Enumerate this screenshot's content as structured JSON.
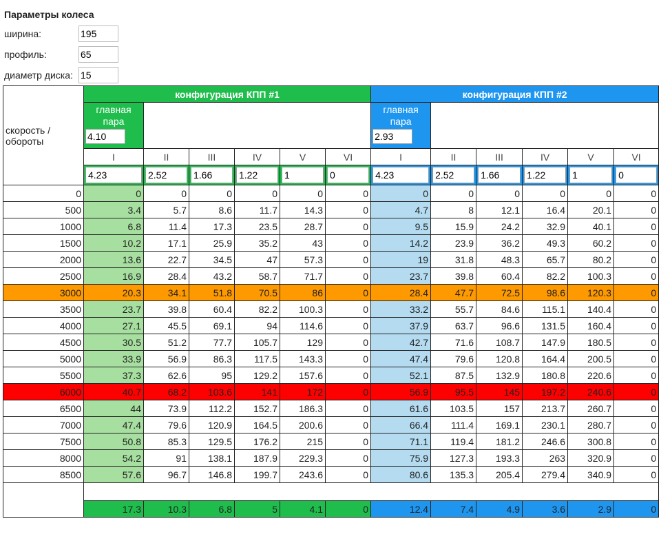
{
  "wheel": {
    "title": "Параметры колеса",
    "width_label": "ширина:",
    "width_value": "195",
    "profile_label": "профиль:",
    "profile_value": "65",
    "diameter_label": "диаметр диска:",
    "diameter_value": "15"
  },
  "table": {
    "speed_label": "скорость / обороты",
    "main_pair_label": "главная пара",
    "gears": [
      "I",
      "II",
      "III",
      "IV",
      "V",
      "VI"
    ],
    "config1": {
      "title": "конфигурация КПП #1",
      "main_pair": "4.10",
      "ratios": [
        "4.23",
        "2.52",
        "1.66",
        "1.22",
        "1",
        "0"
      ]
    },
    "config2": {
      "title": "конфигурация КПП #2",
      "main_pair": "2.93",
      "ratios": [
        "4.23",
        "2.52",
        "1.66",
        "1.22",
        "1",
        "0"
      ]
    },
    "rows": [
      {
        "rpm": "0",
        "c1": [
          "0",
          "0",
          "0",
          "0",
          "0",
          "0"
        ],
        "c2": [
          "0",
          "0",
          "0",
          "0",
          "0",
          "0"
        ]
      },
      {
        "rpm": "500",
        "c1": [
          "3.4",
          "5.7",
          "8.6",
          "11.7",
          "14.3",
          "0"
        ],
        "c2": [
          "4.7",
          "8",
          "12.1",
          "16.4",
          "20.1",
          "0"
        ]
      },
      {
        "rpm": "1000",
        "c1": [
          "6.8",
          "11.4",
          "17.3",
          "23.5",
          "28.7",
          "0"
        ],
        "c2": [
          "9.5",
          "15.9",
          "24.2",
          "32.9",
          "40.1",
          "0"
        ]
      },
      {
        "rpm": "1500",
        "c1": [
          "10.2",
          "17.1",
          "25.9",
          "35.2",
          "43",
          "0"
        ],
        "c2": [
          "14.2",
          "23.9",
          "36.2",
          "49.3",
          "60.2",
          "0"
        ]
      },
      {
        "rpm": "2000",
        "c1": [
          "13.6",
          "22.7",
          "34.5",
          "47",
          "57.3",
          "0"
        ],
        "c2": [
          "19",
          "31.8",
          "48.3",
          "65.7",
          "80.2",
          "0"
        ]
      },
      {
        "rpm": "2500",
        "c1": [
          "16.9",
          "28.4",
          "43.2",
          "58.7",
          "71.7",
          "0"
        ],
        "c2": [
          "23.7",
          "39.8",
          "60.4",
          "82.2",
          "100.3",
          "0"
        ]
      },
      {
        "rpm": "3000",
        "c1": [
          "20.3",
          "34.1",
          "51.8",
          "70.5",
          "86",
          "0"
        ],
        "c2": [
          "28.4",
          "47.7",
          "72.5",
          "98.6",
          "120.3",
          "0"
        ],
        "highlight": "orange"
      },
      {
        "rpm": "3500",
        "c1": [
          "23.7",
          "39.8",
          "60.4",
          "82.2",
          "100.3",
          "0"
        ],
        "c2": [
          "33.2",
          "55.7",
          "84.6",
          "115.1",
          "140.4",
          "0"
        ]
      },
      {
        "rpm": "4000",
        "c1": [
          "27.1",
          "45.5",
          "69.1",
          "94",
          "114.6",
          "0"
        ],
        "c2": [
          "37.9",
          "63.7",
          "96.6",
          "131.5",
          "160.4",
          "0"
        ]
      },
      {
        "rpm": "4500",
        "c1": [
          "30.5",
          "51.2",
          "77.7",
          "105.7",
          "129",
          "0"
        ],
        "c2": [
          "42.7",
          "71.6",
          "108.7",
          "147.9",
          "180.5",
          "0"
        ]
      },
      {
        "rpm": "5000",
        "c1": [
          "33.9",
          "56.9",
          "86.3",
          "117.5",
          "143.3",
          "0"
        ],
        "c2": [
          "47.4",
          "79.6",
          "120.8",
          "164.4",
          "200.5",
          "0"
        ]
      },
      {
        "rpm": "5500",
        "c1": [
          "37.3",
          "62.6",
          "95",
          "129.2",
          "157.6",
          "0"
        ],
        "c2": [
          "52.1",
          "87.5",
          "132.9",
          "180.8",
          "220.6",
          "0"
        ]
      },
      {
        "rpm": "6000",
        "c1": [
          "40.7",
          "68.2",
          "103.6",
          "141",
          "172",
          "0"
        ],
        "c2": [
          "56.9",
          "95.5",
          "145",
          "197.2",
          "240.6",
          "0"
        ],
        "highlight": "red"
      },
      {
        "rpm": "6500",
        "c1": [
          "44",
          "73.9",
          "112.2",
          "152.7",
          "186.3",
          "0"
        ],
        "c2": [
          "61.6",
          "103.5",
          "157",
          "213.7",
          "260.7",
          "0"
        ]
      },
      {
        "rpm": "7000",
        "c1": [
          "47.4",
          "79.6",
          "120.9",
          "164.5",
          "200.6",
          "0"
        ],
        "c2": [
          "66.4",
          "111.4",
          "169.1",
          "230.1",
          "280.7",
          "0"
        ]
      },
      {
        "rpm": "7500",
        "c1": [
          "50.8",
          "85.3",
          "129.5",
          "176.2",
          "215",
          "0"
        ],
        "c2": [
          "71.1",
          "119.4",
          "181.2",
          "246.6",
          "300.8",
          "0"
        ]
      },
      {
        "rpm": "8000",
        "c1": [
          "54.2",
          "91",
          "138.1",
          "187.9",
          "229.3",
          "0"
        ],
        "c2": [
          "75.9",
          "127.3",
          "193.3",
          "263",
          "320.9",
          "0"
        ]
      },
      {
        "rpm": "8500",
        "c1": [
          "57.6",
          "96.7",
          "146.8",
          "199.7",
          "243.6",
          "0"
        ],
        "c2": [
          "80.6",
          "135.3",
          "205.4",
          "279.4",
          "340.9",
          "0"
        ]
      }
    ],
    "footer": {
      "c1": [
        "17.3",
        "10.3",
        "6.8",
        "5",
        "4.1",
        "0"
      ],
      "c2": [
        "12.4",
        "7.4",
        "4.9",
        "3.6",
        "2.9",
        "0"
      ]
    }
  },
  "colors": {
    "config1": "#1fbe4c",
    "config2": "#1e96f0",
    "config1_first_gear": "#a6df9f",
    "config2_first_gear": "#b4dbf0",
    "rpm_3000_highlight": "#ff9900",
    "rpm_6000_highlight": "#ff0000"
  }
}
